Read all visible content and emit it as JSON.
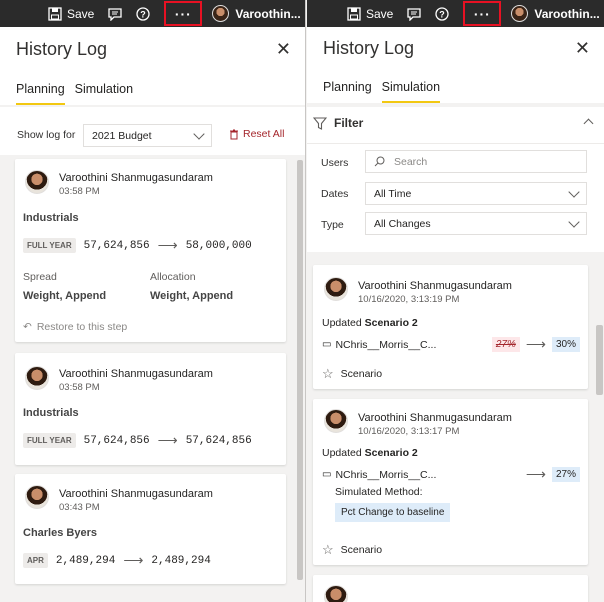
{
  "topbar": {
    "save_label": "Save",
    "more_label": "···",
    "left_user": "Varoothin...",
    "right_user": "Varoothin..."
  },
  "left": {
    "title": "History Log",
    "tabs": [
      "Planning",
      "Simulation"
    ],
    "show_log_label": "Show log for",
    "budget_value": "2021 Budget",
    "reset_label": "Reset All",
    "cards": [
      {
        "user": "Varoothini Shanmugasundaram",
        "time": "03:58 PM",
        "category": "Industrials",
        "period": "FULL YEAR",
        "from": "57,624,856",
        "to": "58,000,000",
        "spread_label": "Spread",
        "spread_value": "Weight, Append",
        "allocation_label": "Allocation",
        "allocation_value": "Weight, Append",
        "restore_label": "Restore to this step"
      },
      {
        "user": "Varoothini Shanmugasundaram",
        "time": "03:58 PM",
        "category": "Industrials",
        "period": "FULL YEAR",
        "from": "57,624,856",
        "to": "57,624,856"
      },
      {
        "user": "Varoothini Shanmugasundaram",
        "time": "03:43 PM",
        "category": "Charles Byers",
        "period": "APR",
        "from": "2,489,294",
        "to": "2,489,294"
      }
    ]
  },
  "right": {
    "title": "History Log",
    "tabs": [
      "Planning",
      "Simulation"
    ],
    "filter_label": "Filter",
    "users_label": "Users",
    "search_placeholder": "Search",
    "dates_label": "Dates",
    "dates_value": "All Time",
    "type_label": "Type",
    "type_value": "All Changes",
    "cards": [
      {
        "user": "Varoothini Shanmugasundaram",
        "time": "10/16/2020, 3:13:19 PM",
        "updated_prefix": "Updated",
        "scenario_name": "Scenario 2",
        "measure": "NChris__Morris__C...",
        "old_pct": "27%",
        "new_pct": "30%",
        "scenario_label": "Scenario"
      },
      {
        "user": "Varoothini Shanmugasundaram",
        "time": "10/16/2020, 3:13:17 PM",
        "updated_prefix": "Updated",
        "scenario_name": "Scenario 2",
        "measure": "NChris__Morris__C...",
        "new_pct": "27%",
        "method_label": "Simulated Method:",
        "method_value": "Pct Change to baseline",
        "scenario_label": "Scenario"
      }
    ]
  },
  "colors": {
    "accent_tab": "#f2c811",
    "highlight_red": "#e81123",
    "reset_red": "#a4262c",
    "topbar": "#2b2b2b"
  }
}
